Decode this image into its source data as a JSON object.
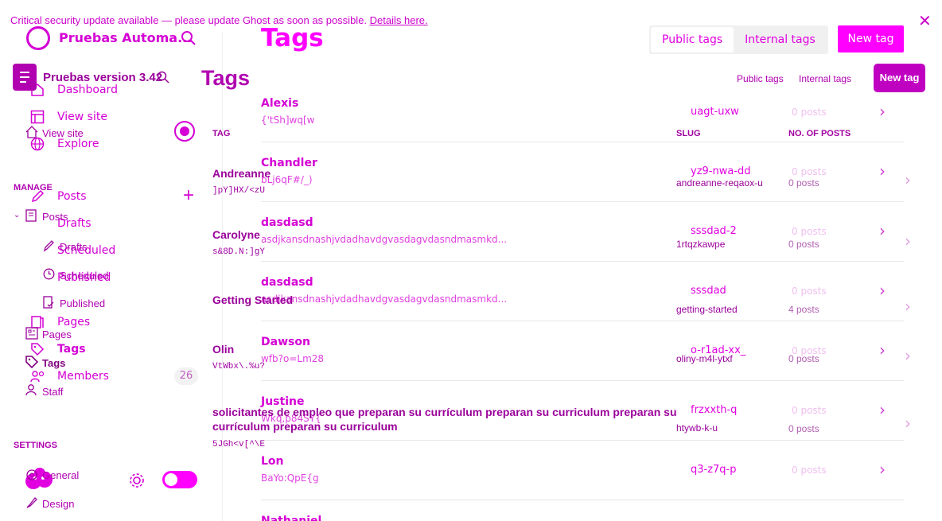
{
  "banner": {
    "text": "Critical security update available — please update Ghost as soon as possible.",
    "link": "Details here."
  },
  "layerA": {
    "site_title": "Pruebas Automa...",
    "nav": {
      "dashboard": "Dashboard",
      "view_site": "View site",
      "explore": "Explore",
      "posts": "Posts",
      "drafts": "Drafts",
      "scheduled": "Scheduled",
      "published": "Published",
      "pages": "Pages",
      "tags": "Tags",
      "members": "Members",
      "members_count": "26"
    },
    "page_title": "Tags",
    "tabs": {
      "public": "Public tags",
      "internal": "Internal tags"
    },
    "new_tag": "New tag",
    "rows": [
      {
        "name": "Alexis",
        "desc": "{'tSh]wq[w",
        "slug": "uagt-uxw",
        "count": "0 posts"
      },
      {
        "name": "Chandler",
        "desc": "bLj6qF#/_)",
        "slug": "yz9-nwa-dd",
        "count": "0 posts"
      },
      {
        "name": "dasdasd",
        "desc": "asdjkansdnashjvdadhavdgvasdagvdasndmasmkd...",
        "slug": "sssdad-2",
        "count": "0 posts"
      },
      {
        "name": "dasdasd",
        "desc": "asdjkansdnashjvdadhavdgvasdagvdasndmasmkd...",
        "slug": "sssdad",
        "count": "0 posts"
      },
      {
        "name": "Dawson",
        "desc": "wfb?o=Lm28",
        "slug": "o-r1ad-xx_",
        "count": "0 posts"
      },
      {
        "name": "Justine",
        "desc": "Wkq,p84SY{",
        "slug": "frzxxth-q",
        "count": "0 posts"
      },
      {
        "name": "Lon",
        "desc": "BaYo:QpE{g",
        "slug": "q3-z7q-p",
        "count": "0 posts"
      },
      {
        "name": "Nathaniel",
        "desc": "",
        "slug": "",
        "count": ""
      }
    ]
  },
  "layerB": {
    "site_title": "Pruebas version 3.42",
    "nav": {
      "view_site": "View site",
      "manage": "MANAGE",
      "posts": "Posts",
      "drafts": "Drafts",
      "scheduled": "Scheduled",
      "published": "Published",
      "pages": "Pages",
      "tags": "Tags",
      "staff": "Staff",
      "settings": "SETTINGS",
      "general": "General",
      "design": "Design"
    },
    "page_title": "Tags",
    "tabs": {
      "public": "Public tags",
      "internal": "Internal tags"
    },
    "new_tag": "New tag",
    "headers": {
      "tag": "TAG",
      "slug": "SLUG",
      "posts": "NO. OF POSTS"
    },
    "rows": [
      {
        "name": "Andreanne",
        "desc": "]pY]HX/<zU",
        "slug": "andreanne-reqaox-u",
        "count": "0 posts"
      },
      {
        "name": "Carolyne",
        "desc": "s&8D.N:]gY",
        "slug": "1rtqzkawpe",
        "count": "0 posts"
      },
      {
        "name": "Getting Started",
        "desc": "",
        "slug": "getting-started",
        "count": "4 posts"
      },
      {
        "name": "Olin",
        "desc": "VtWbx\\.%u?",
        "slug": "oliny-m4l-ytxf",
        "count": "0 posts"
      },
      {
        "name": "solicitantes de empleo que preparan su currículum preparan su curriculum preparan su",
        "name2": "currículum preparan su curriculum",
        "desc": "5JGh<v[^\\E",
        "slug": "htywb-k-u",
        "count": "0 posts"
      }
    ]
  }
}
